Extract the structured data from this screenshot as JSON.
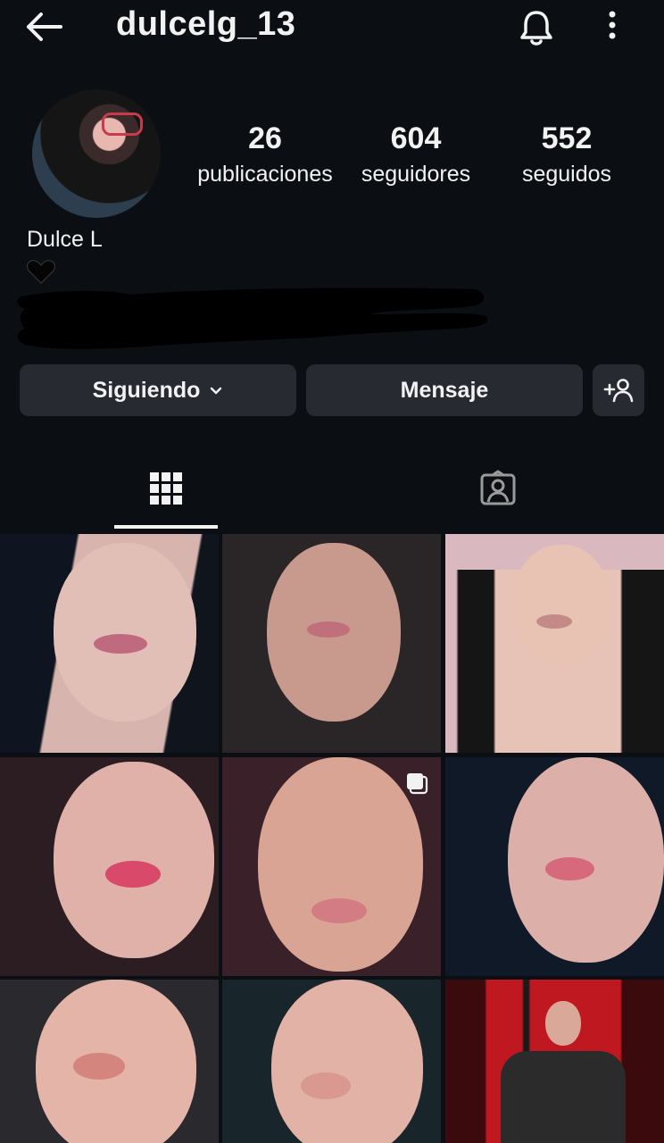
{
  "header": {
    "username": "dulcelg_13",
    "back_icon": "arrow-left-icon",
    "notifications_icon": "bell-icon",
    "more_icon": "more-vertical-icon"
  },
  "profile": {
    "display_name": "Dulce L",
    "bio_emoji": "black-heart-icon",
    "stats": [
      {
        "value": "26",
        "label": "publicaciones"
      },
      {
        "value": "604",
        "label": "seguidores"
      },
      {
        "value": "552",
        "label": "seguidos"
      }
    ]
  },
  "actions": {
    "following_label": "Siguiendo",
    "message_label": "Mensaje",
    "add_person_icon": "person-add-icon"
  },
  "tabs": [
    {
      "name": "grid",
      "icon": "grid-icon",
      "active": true
    },
    {
      "name": "tagged",
      "icon": "tagged-person-icon",
      "active": false
    }
  ],
  "colors": {
    "background": "#0b0f14",
    "button": "#272b31",
    "text": "#f2f2f2"
  },
  "posts": [
    {
      "id": 1,
      "multi": false
    },
    {
      "id": 2,
      "multi": false
    },
    {
      "id": 3,
      "multi": false
    },
    {
      "id": 4,
      "multi": false
    },
    {
      "id": 5,
      "multi": true
    },
    {
      "id": 6,
      "multi": false
    },
    {
      "id": 7,
      "multi": false
    },
    {
      "id": 8,
      "multi": false
    },
    {
      "id": 9,
      "multi": false
    }
  ]
}
